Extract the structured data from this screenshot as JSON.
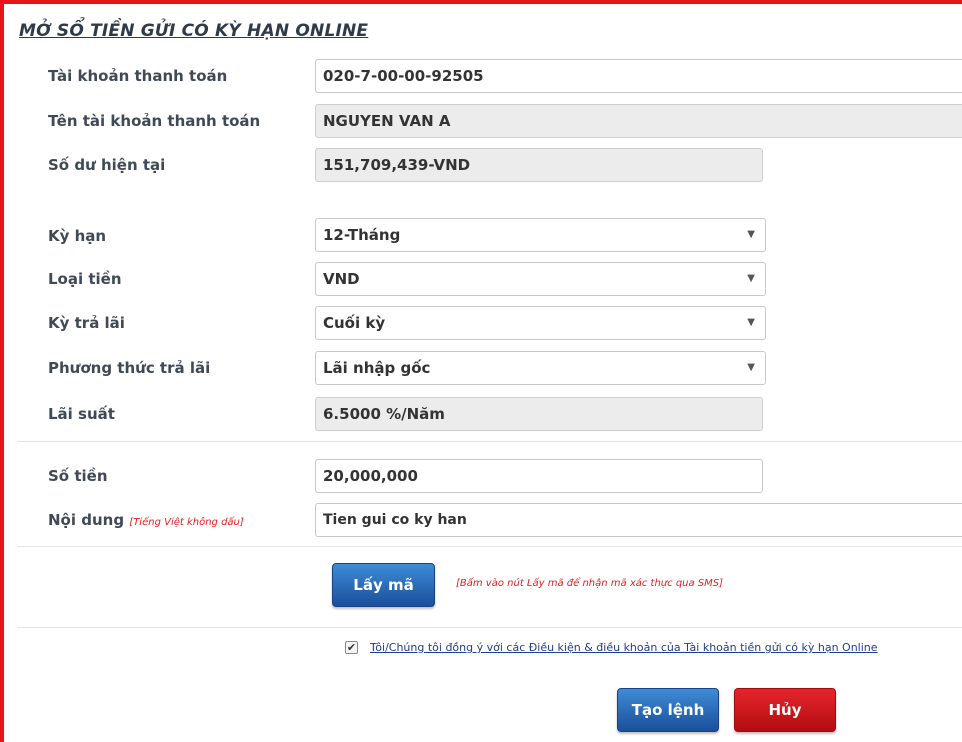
{
  "title": "MỞ SỔ TIỀN GỬI CÓ KỲ HẠN ONLINE",
  "form": {
    "account": {
      "label": "Tài khoản thanh toán",
      "value": "020-7-00-00-92505"
    },
    "account_name": {
      "label": "Tên tài khoản thanh toán",
      "value": "NGUYEN VAN A"
    },
    "balance": {
      "label": "Số dư hiện tại",
      "value": "151,709,439-VND"
    },
    "term": {
      "label": "Kỳ hạn",
      "value": "12-Tháng"
    },
    "currency": {
      "label": "Loại tiền",
      "value": "VND"
    },
    "interest_period": {
      "label": "Kỳ trả lãi",
      "value": "Cuối kỳ"
    },
    "interest_method": {
      "label": "Phương thức trả lãi",
      "value": "Lãi nhập gốc"
    },
    "rate": {
      "label": "Lãi suất",
      "value": "6.5000 %/Năm"
    },
    "amount": {
      "label": "Số tiền",
      "value": "20,000,000"
    },
    "content": {
      "label": "Nội dung",
      "hint": "[Tiếng Việt không dấu]",
      "value": "Tien gui co ky han"
    }
  },
  "get_code": {
    "label": "Lấy mã",
    "hint": "[Bấm vào nút Lấy mã để nhận mã xác thực qua SMS]"
  },
  "terms": {
    "checked": true,
    "text": "Tôi/Chúng tôi đồng ý với các Điều kiện & điều khoản của Tài khoản tiền gửi có kỳ hạn Online"
  },
  "actions": {
    "create_label": "Tạo lệnh",
    "cancel_label": "Hủy"
  },
  "icons": {
    "dropdown": "▼",
    "check": "✔"
  },
  "colors": {
    "frame": "#e8141b",
    "primary": "#1b4f9b",
    "danger": "#c4141a",
    "hint": "#e02020"
  }
}
